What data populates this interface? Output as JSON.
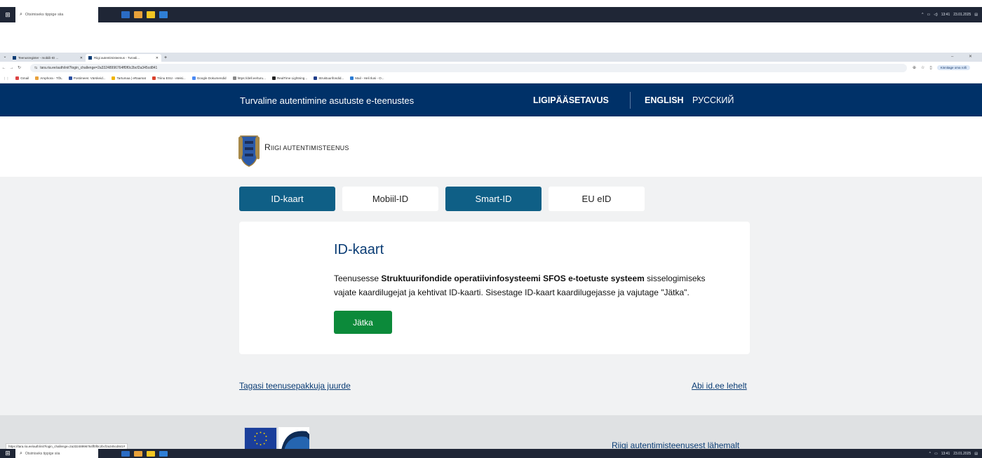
{
  "os": {
    "search_placeholder": "Otsimiseks tippige siia",
    "tray_time": "13:41",
    "tray_date": "23.01.2025"
  },
  "browser": {
    "tabs": [
      {
        "title": "Teenusregister - mobiili-ID ...",
        "active": false
      },
      {
        "title": "Riigi autentimisteenus - Turvali...",
        "active": true
      }
    ],
    "url": "tara.ria.ee/auth/init?login_challenge=2a33248996764ff0f0c2bcf2a345cd841",
    "profile_label": "Kinnitage oma rolli",
    "status_url": "https://tara.ria.ee/auth/init?login_challenge=2a33248996764ff0f0c2bcf2a345cd841#",
    "bookmarks": [
      "Gmail",
      "Amphora - TÖL",
      "Postimees: Värskeid...",
      "Tartumaa | eRaamat",
      "Triinu ESU - eteisi...",
      "Google Dokumendid",
      "https://dell.ee/turu...",
      "RealTime Lightning...",
      "Struktuurifondid...",
      "Mail - Heli Ilusi - O..."
    ]
  },
  "header": {
    "tagline": "Turvaline autentimine asutuste e-teenustes",
    "accessibility": "LIGIPÄÄSETAVUS",
    "lang_en": "ENGLISH",
    "lang_ru": "РУССКИЙ"
  },
  "brand": {
    "name_first_letter": "R",
    "name_rest": "IIGI AUTENTIMISTEENUS"
  },
  "methods": [
    {
      "label": "ID-kaart",
      "active": true
    },
    {
      "label": "Mobiil-ID",
      "active": false
    },
    {
      "label": "Smart-ID",
      "active": true
    },
    {
      "label": "EU eID",
      "active": false
    }
  ],
  "card": {
    "title": "ID-kaart",
    "text_before": "Teenusesse ",
    "service_name": "Struktuurifondide operatiivinfosysteemi  SFOS e-toetuste systeem",
    "text_after": " sisselogimiseks vajate kaardilugejat ja kehtivat ID-kaarti. Sisestage ID-kaart kaardilugejasse ja vajutage \"Jätka\".",
    "button": "Jätka"
  },
  "links": {
    "back": "Tagasi teenusepakkuja juurde",
    "help": "Abi id.ee lehelt"
  },
  "footer": {
    "about": "Riigi autentimisteenusest lähemalt"
  },
  "colors": {
    "nav_bg": "#003168",
    "tab_active": "#0f5f86",
    "button_green": "#0c8a3a",
    "link": "#0b3d75"
  }
}
